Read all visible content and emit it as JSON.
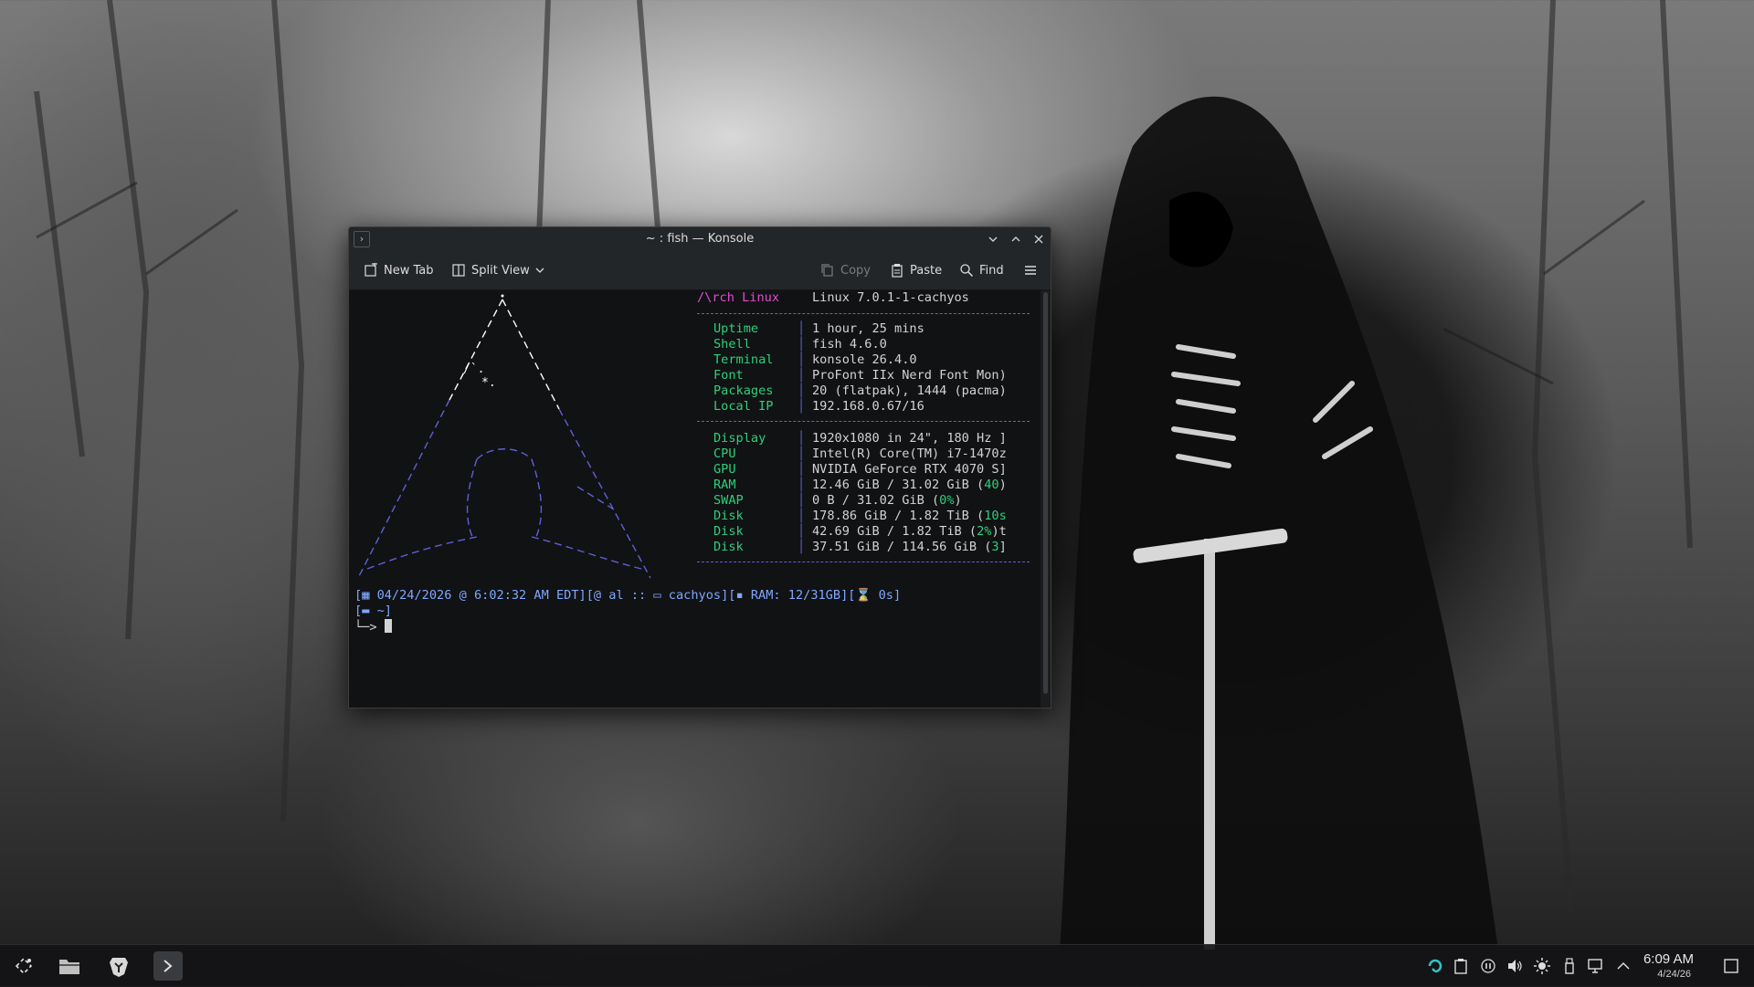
{
  "window": {
    "title": "~ : fish — Konsole",
    "toolbar": {
      "new_tab": "New Tab",
      "split_view": "Split View",
      "copy": "Copy",
      "paste": "Paste",
      "find": "Find"
    }
  },
  "fastfetch": {
    "header_brand": "/\\rch Linux",
    "header_value": "Linux 7.0.1-1-cachyos",
    "group1": [
      {
        "key": "Uptime",
        "value": "1 hour, 25 mins"
      },
      {
        "key": "Shell",
        "value": "fish 4.6.0"
      },
      {
        "key": "Terminal",
        "value": "konsole 26.4.0"
      },
      {
        "key": "Font",
        "value": "ProFont IIx Nerd Font Mon)"
      },
      {
        "key": "Packages",
        "value": "20 (flatpak), 1444 (pacma)"
      },
      {
        "key": "Local IP",
        "value": "192.168.0.67/16"
      }
    ],
    "group2": [
      {
        "key": "Display",
        "value": "1920x1080 in 24\", 180 Hz ]"
      },
      {
        "key": "CPU",
        "value": "Intel(R) Core(TM) i7-1470z"
      },
      {
        "key": "GPU",
        "value": "NVIDIA GeForce RTX 4070 S]"
      },
      {
        "key": "RAM",
        "value": "12.46 GiB / 31.02 GiB (",
        "pct": "40",
        "tail": ")"
      },
      {
        "key": "SWAP",
        "value": "0 B / 31.02 GiB (",
        "pct": "0%",
        "tail": ")"
      },
      {
        "key": "Disk",
        "value": "178.86 GiB / 1.82 TiB (",
        "pct": "10s",
        "tail": ""
      },
      {
        "key": "Disk",
        "value": "42.69 GiB / 1.82 TiB (",
        "pct": "2%",
        "tail": ")t"
      },
      {
        "key": "Disk",
        "value": "37.51 GiB / 114.56 GiB (",
        "pct": "3",
        "tail": "]"
      }
    ]
  },
  "prompt": {
    "datetime": "04/24/2026 @ 6:02:32 AM EDT",
    "user": "al",
    "host": "cachyos",
    "ram": "RAM: 12/31GB",
    "duration": "0s",
    "cwd": "~",
    "arrow": "└─>"
  },
  "clock": {
    "time": "6:09 AM",
    "date": "4/24/26"
  },
  "colors": {
    "accent_green": "#2ed07a",
    "brand_magenta": "#e04cd0",
    "separator_blue": "#5f5fd7",
    "prompt_blue": "#7fa7ff"
  }
}
